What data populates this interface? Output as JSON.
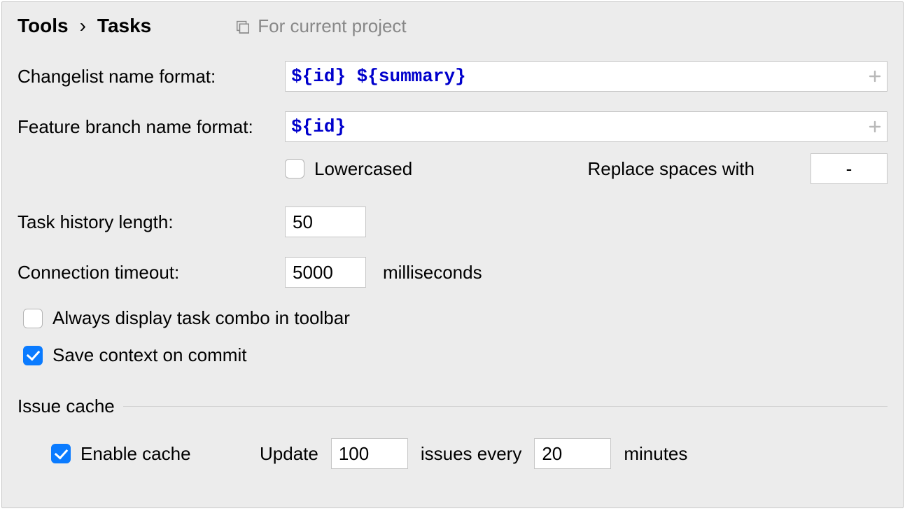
{
  "breadcrumb": {
    "parent": "Tools",
    "current": "Tasks"
  },
  "scope_label": "For current project",
  "changelist": {
    "label": "Changelist name format:",
    "value_tokens": [
      "${",
      "id",
      "}",
      " ",
      "${",
      "summary",
      "}"
    ]
  },
  "branch": {
    "label": "Feature branch name format:",
    "value_tokens": [
      "${",
      "id",
      "}"
    ]
  },
  "lowercased": {
    "label": "Lowercased",
    "checked": false
  },
  "replace_spaces": {
    "label": "Replace spaces with",
    "value": "-"
  },
  "task_history": {
    "label": "Task history length:",
    "value": "50"
  },
  "timeout": {
    "label": "Connection timeout:",
    "value": "5000",
    "unit": "milliseconds"
  },
  "always_display": {
    "label": "Always display task combo in toolbar",
    "checked": false
  },
  "save_context": {
    "label": "Save context on commit",
    "checked": true
  },
  "issue_cache": {
    "title": "Issue cache",
    "enable": {
      "label": "Enable cache",
      "checked": true
    },
    "update_prefix": "Update",
    "count": "100",
    "mid": "issues every",
    "interval": "20",
    "unit": "minutes"
  }
}
